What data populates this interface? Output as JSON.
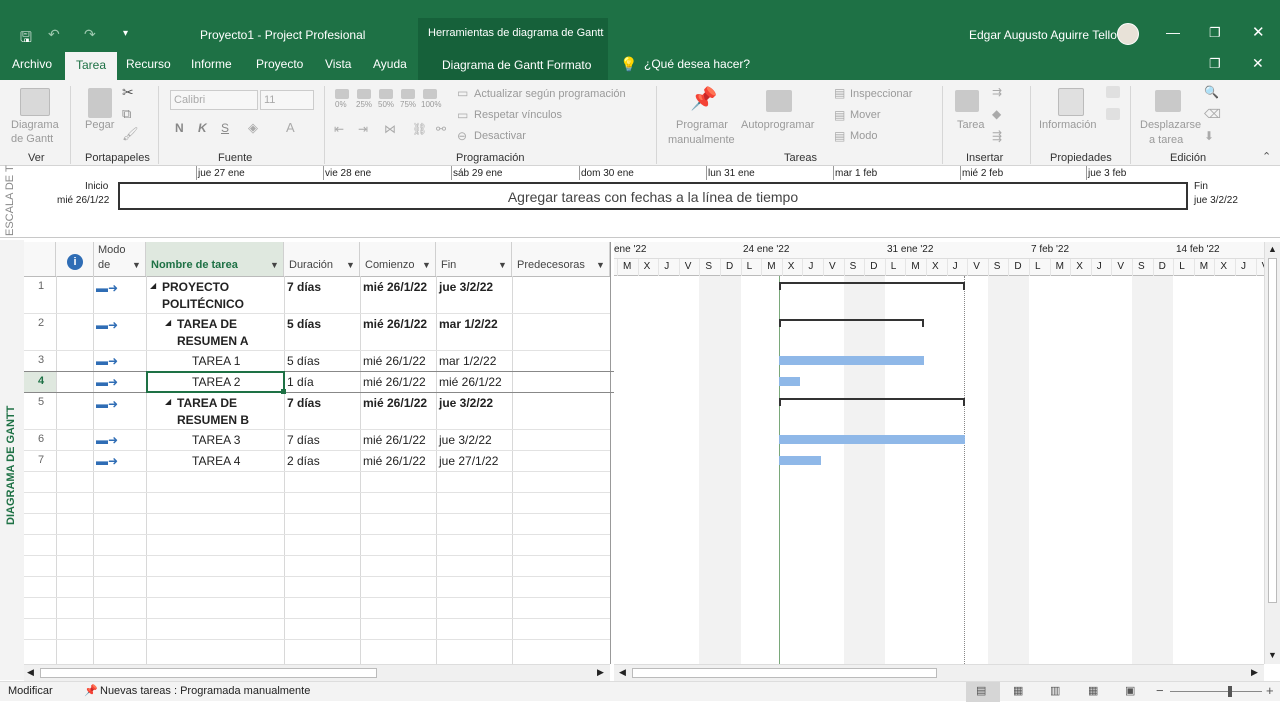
{
  "window": {
    "title": "Proyecto1  -  Project Profesional",
    "context_tool": "Herramientas de diagrama de Gantt",
    "user": "Edgar Augusto Aguirre Tello"
  },
  "tabs": {
    "archivo": "Archivo",
    "tarea": "Tarea",
    "recurso": "Recurso",
    "informe": "Informe",
    "proyecto": "Proyecto",
    "vista": "Vista",
    "ayuda": "Ayuda",
    "formato": "Diagrama de Gantt  Formato",
    "search": "¿Qué desea hacer?"
  },
  "ribbon": {
    "ver_btn": [
      "Diagrama",
      "de Gantt"
    ],
    "ver": "Ver",
    "pegar": "Pegar",
    "portapapeles": "Portapapeles",
    "font_name": "Calibri",
    "font_size": "11",
    "fuente": "Fuente",
    "actualizar": "Actualizar según programación",
    "respetar": "Respetar vínculos",
    "desactivar": "Desactivar",
    "programacion": "Programación",
    "programar_manual": [
      "Programar",
      "manualmente"
    ],
    "autoprogramar": "Autoprogramar",
    "inspeccionar": "Inspeccionar",
    "mover": "Mover",
    "modo": "Modo",
    "tareas": "Tareas",
    "tarea_btn": "Tarea",
    "insertar": "Insertar",
    "informacion": "Información",
    "propiedades": "Propiedades",
    "desplazarse": [
      "Desplazarse",
      "a tarea"
    ],
    "edicion": "Edición",
    "percents": [
      "0%",
      "25%",
      "50%",
      "75%",
      "100%"
    ]
  },
  "timeline": {
    "side_label": "ESCALA DE T",
    "inicio_label": "Inicio",
    "inicio_date": "mié 26/1/22",
    "fin_label": "Fin",
    "fin_date": "jue 3/2/22",
    "placeholder": "Agregar tareas con fechas a la línea de tiempo",
    "dates": [
      "jue 27 ene",
      "vie 28 ene",
      "sáb 29 ene",
      "dom 30 ene",
      "lun 31 ene",
      "mar 1 feb",
      "mié 2 feb",
      "jue 3 feb"
    ]
  },
  "grid": {
    "side_label": "DIAGRAMA DE GANTT",
    "headers": {
      "modo": [
        "Modo",
        "de"
      ],
      "nombre": "Nombre de tarea",
      "duracion": "Duración",
      "comienzo": "Comienzo",
      "fin": "Fin",
      "pred": "Predecesoras"
    },
    "rows": [
      {
        "id": "1",
        "name": [
          "PROYECTO",
          "POLITÉCNICO"
        ],
        "dur": "7 días",
        "start": "mié 26/1/22",
        "end": "jue 3/2/22",
        "bold": true,
        "level": 0
      },
      {
        "id": "2",
        "name": [
          "TAREA DE",
          "RESUMEN A"
        ],
        "dur": "5 días",
        "start": "mié 26/1/22",
        "end": "mar 1/2/22",
        "bold": true,
        "level": 1
      },
      {
        "id": "3",
        "name": [
          "TAREA 1"
        ],
        "dur": "5 días",
        "start": "mié 26/1/22",
        "end": "mar 1/2/22",
        "bold": false,
        "level": 2
      },
      {
        "id": "4",
        "name": [
          "TAREA 2"
        ],
        "dur": "1 día",
        "start": "mié 26/1/22",
        "end": "mié 26/1/22",
        "bold": false,
        "level": 2
      },
      {
        "id": "5",
        "name": [
          "TAREA DE",
          "RESUMEN B"
        ],
        "dur": "7 días",
        "start": "mié 26/1/22",
        "end": "jue 3/2/22",
        "bold": true,
        "level": 1
      },
      {
        "id": "6",
        "name": [
          "TAREA 3"
        ],
        "dur": "7 días",
        "start": "mié 26/1/22",
        "end": "jue 3/2/22",
        "bold": false,
        "level": 2
      },
      {
        "id": "7",
        "name": [
          "TAREA 4"
        ],
        "dur": "2 días",
        "start": "mié 26/1/22",
        "end": "jue 27/1/22",
        "bold": false,
        "level": 2
      }
    ]
  },
  "gantt": {
    "weeks": [
      "ene '22",
      "24 ene '22",
      "31 ene '22",
      "7 feb '22",
      "14 feb '22"
    ],
    "days": [
      "M",
      "X",
      "J",
      "V",
      "S",
      "D",
      "L",
      "M",
      "X",
      "J",
      "V",
      "S",
      "D",
      "L",
      "M",
      "X",
      "J",
      "V",
      "S",
      "D",
      "L",
      "M",
      "X",
      "J",
      "V",
      "S",
      "D",
      "L",
      "M",
      "X",
      "J",
      "V"
    ]
  },
  "status": {
    "mode": "Modificar",
    "new_tasks": "Nuevas tareas : Programada manualmente"
  },
  "colors": {
    "accent": "#1e7145",
    "bar": "#8fb8e8"
  }
}
